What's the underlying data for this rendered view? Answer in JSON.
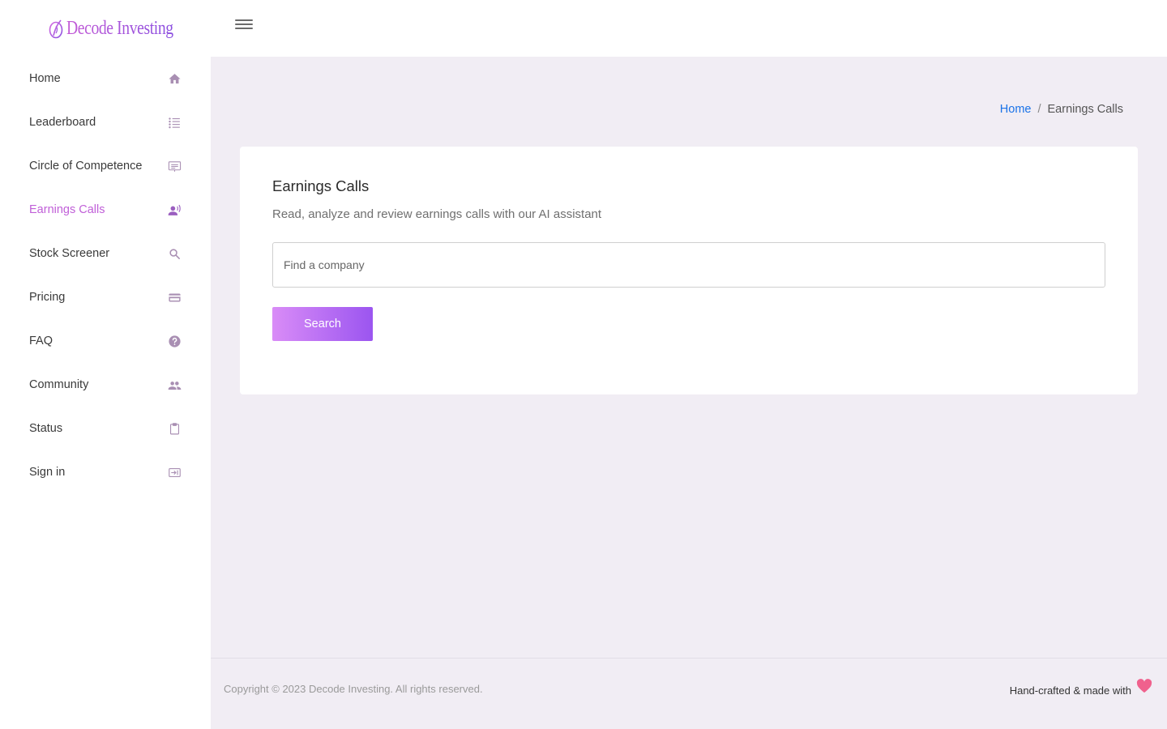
{
  "brand": {
    "name": "Decode Investing",
    "accent": "#c05fd8"
  },
  "sidebar": {
    "items": [
      {
        "label": "Home",
        "icon": "home-icon",
        "active": false
      },
      {
        "label": "Leaderboard",
        "icon": "list-icon",
        "active": false
      },
      {
        "label": "Circle of Competence",
        "icon": "presentation-icon",
        "active": false
      },
      {
        "label": "Earnings Calls",
        "icon": "record-voice-icon",
        "active": true
      },
      {
        "label": "Stock Screener",
        "icon": "search-icon",
        "active": false
      },
      {
        "label": "Pricing",
        "icon": "credit-card-icon",
        "active": false
      },
      {
        "label": "FAQ",
        "icon": "help-icon",
        "active": false
      },
      {
        "label": "Community",
        "icon": "people-icon",
        "active": false
      },
      {
        "label": "Status",
        "icon": "clipboard-icon",
        "active": false
      },
      {
        "label": "Sign in",
        "icon": "sign-in-icon",
        "active": false
      }
    ]
  },
  "breadcrumb": {
    "home": "Home",
    "separator": "/",
    "current": "Earnings Calls"
  },
  "card": {
    "title": "Earnings Calls",
    "subtitle": "Read, analyze and review earnings calls with our AI assistant",
    "search_placeholder": "Find a company",
    "search_value": "",
    "search_button": "Search"
  },
  "footer": {
    "copyright": "Copyright © 2023 Decode Investing. All rights reserved.",
    "handcrafted": "Hand-crafted & made with"
  }
}
